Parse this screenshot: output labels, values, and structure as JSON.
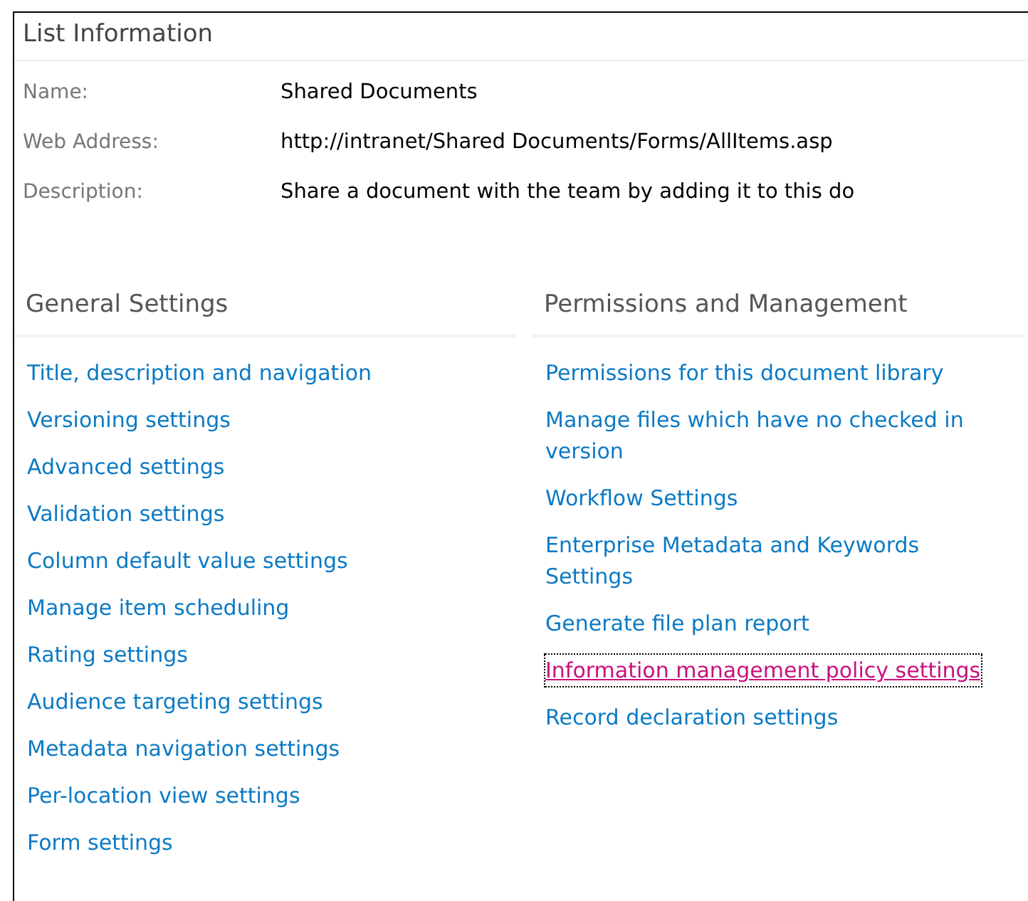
{
  "title": "List Information",
  "info": [
    {
      "label": "Name:",
      "value": "Shared Documents"
    },
    {
      "label": "Web Address:",
      "value": "http://intranet/Shared Documents/Forms/AllItems.asp"
    },
    {
      "label": "Description:",
      "value": "Share a document with the team by adding it to this do"
    }
  ],
  "sections": [
    {
      "heading": "General Settings",
      "links": [
        {
          "label": "Title, description and navigation",
          "focused": false
        },
        {
          "label": "Versioning settings",
          "focused": false
        },
        {
          "label": "Advanced settings",
          "focused": false
        },
        {
          "label": "Validation settings",
          "focused": false
        },
        {
          "label": "Column default value settings",
          "focused": false
        },
        {
          "label": "Manage item scheduling",
          "focused": false
        },
        {
          "label": "Rating settings",
          "focused": false
        },
        {
          "label": "Audience targeting settings",
          "focused": false
        },
        {
          "label": "Metadata navigation settings",
          "focused": false
        },
        {
          "label": "Per-location view settings",
          "focused": false
        },
        {
          "label": "Form settings",
          "focused": false
        }
      ]
    },
    {
      "heading": "Permissions and Management",
      "links": [
        {
          "label": "Permissions for this document library",
          "focused": false
        },
        {
          "label": "Manage files which have no checked in version",
          "focused": false
        },
        {
          "label": "Workflow Settings",
          "focused": false
        },
        {
          "label": "Enterprise Metadata and Keywords Settings",
          "focused": false
        },
        {
          "label": "Generate file plan report",
          "focused": false
        },
        {
          "label": "Information management policy settings",
          "focused": true
        },
        {
          "label": "Record declaration settings",
          "focused": false
        }
      ]
    }
  ]
}
